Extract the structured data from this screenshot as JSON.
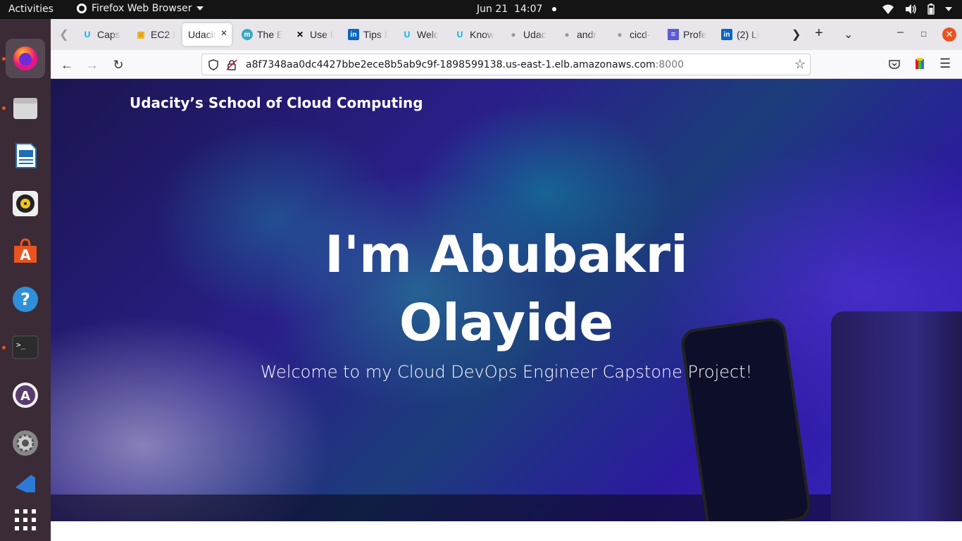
{
  "topbar": {
    "activities": "Activities",
    "app_name": "Firefox Web Browser",
    "date": "Jun 21",
    "time": "14:07"
  },
  "dock": {
    "apps": [
      "firefox-icon",
      "files-icon",
      "writer-icon",
      "rhythmbox-icon",
      "software-icon",
      "help-icon",
      "terminal-icon",
      "app-center-icon",
      "settings-icon",
      "vscode-icon",
      "show-apps-icon"
    ]
  },
  "tabs": [
    {
      "label": "Caps",
      "icon": "udacity-icon",
      "color": "#02b3e4"
    },
    {
      "label": "EC2 I",
      "icon": "aws-icon",
      "color": "#e8a400"
    },
    {
      "label": "Udacit",
      "icon": "",
      "color": "",
      "active": true
    },
    {
      "label": "The E",
      "icon": "m-icon",
      "color": "#39a7c6"
    },
    {
      "label": "Use I",
      "icon": "x-icon",
      "color": "#000000"
    },
    {
      "label": "Tips I",
      "icon": "linkedin-icon",
      "color": "#0a66c2"
    },
    {
      "label": "Welc",
      "icon": "udacity-icon",
      "color": "#02b3e4"
    },
    {
      "label": "Know",
      "icon": "udacity-icon",
      "color": "#02b3e4"
    },
    {
      "label": "Udac",
      "icon": "github-icon",
      "color": "#333333"
    },
    {
      "label": "andr",
      "icon": "github-icon",
      "color": "#333333"
    },
    {
      "label": "cicd-",
      "icon": "github-icon",
      "color": "#333333"
    },
    {
      "label": "Profe",
      "icon": "docs-icon",
      "color": "#5b5bd6"
    },
    {
      "label": "(2) Li",
      "icon": "linkedin-icon",
      "color": "#0a66c2"
    }
  ],
  "navbar": {
    "url_host": "a8f7348aa0dc4427bbe2ece8b5ab9c9f-1898599138.us-east-1.elb.amazonaws.com",
    "url_port": ":8000"
  },
  "page": {
    "brand": "Udacity’s School of Cloud Computing",
    "title_line1": "I'm Abubakri",
    "title_line2": "Olayide",
    "subtitle": "Welcome to my Cloud DevOps Engineer Capstone Project!"
  }
}
